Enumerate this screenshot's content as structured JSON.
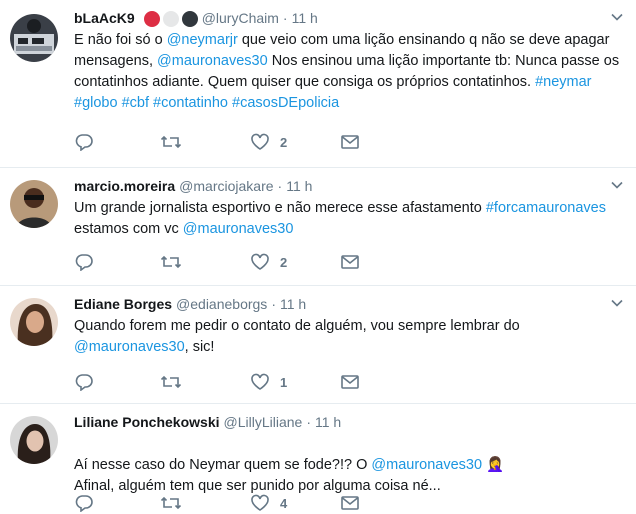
{
  "tweets": [
    {
      "name": "bLaAcK9",
      "handle": "@luryChaim",
      "sep": "·",
      "time": "11 h",
      "text_parts": [
        {
          "t": "E não foi só o ",
          "link": false
        },
        {
          "t": "@neymarjr",
          "link": true
        },
        {
          "t": " que veio com uma lição ensinando q não se deve apagar mensagens, ",
          "link": false
        },
        {
          "t": "@mauronaves30",
          "link": true
        },
        {
          "t": " Nos ensinou uma lição importante tb: Nunca passe os contatinhos adiante. Quem quiser que consiga os próprios contatinhos. ",
          "link": false
        },
        {
          "t": "#neymar #globo #cbf #contatinho #casosDEpolicia",
          "link": true
        }
      ],
      "like_count": "2"
    },
    {
      "name": "marcio.moreira",
      "handle": "@marciojakare",
      "sep": "·",
      "time": "11 h",
      "text_parts": [
        {
          "t": "Um grande jornalista esportivo e não merece esse afastamento ",
          "link": false
        },
        {
          "t": "#forcamauronaves",
          "link": true
        },
        {
          "t": " estamos com vc ",
          "link": false
        },
        {
          "t": "@mauronaves30",
          "link": true
        }
      ],
      "like_count": "2"
    },
    {
      "name": "Ediane Borges",
      "handle": "@edianeborgs",
      "sep": "·",
      "time": "11 h",
      "text_parts": [
        {
          "t": "Quando forem me pedir o contato de alguém, vou sempre lembrar do ",
          "link": false
        },
        {
          "t": "@mauronaves30",
          "link": true
        },
        {
          "t": ", sic!",
          "link": false
        }
      ],
      "like_count": "1"
    },
    {
      "name": "Liliane Ponchekowski",
      "handle": "@LillyLiliane",
      "sep": "·",
      "time": "11 h",
      "text_parts": [
        {
          "t": "Aí nesse caso do Neymar quem se fode?!? O ",
          "link": false
        },
        {
          "t": "@mauronaves30",
          "link": true
        },
        {
          "t": " 🤦‍♀️",
          "link": false
        },
        {
          "t": "\nAfinal, alguém tem que ser punido por alguma coisa né...",
          "link": false
        }
      ],
      "like_count": "4"
    }
  ],
  "icons": {
    "reply": "reply-icon",
    "retweet": "retweet-icon",
    "like": "heart-icon",
    "dm": "envelope-icon",
    "caret": "chevron-down-icon"
  },
  "colors": {
    "link": "#1b95e0",
    "muted": "#657786",
    "text": "#14171a",
    "divider": "#e6ecf0"
  }
}
